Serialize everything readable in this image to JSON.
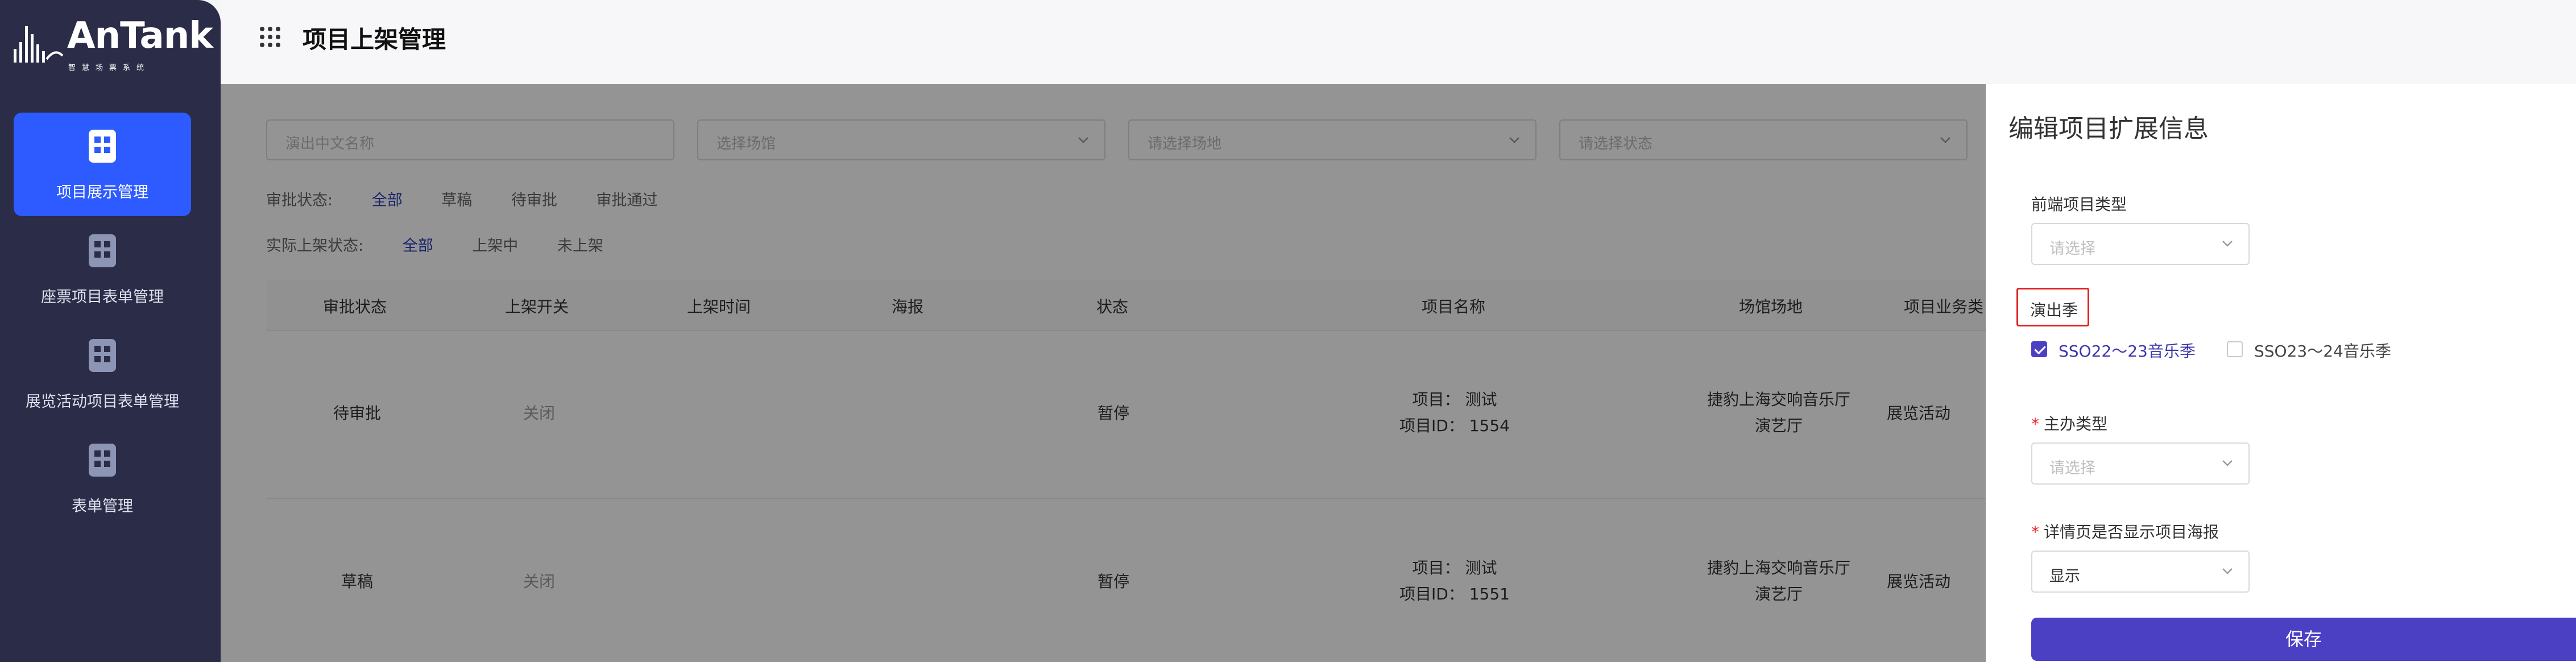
{
  "app": {
    "logo": {
      "name": "AnTank",
      "subtitle": "智慧场票系统"
    },
    "page_title": "项目上架管理"
  },
  "sidebar": {
    "items": [
      {
        "label": "项目展示管理",
        "active": true,
        "icon": "building-icon"
      },
      {
        "label": "座票项目表单管理",
        "active": false,
        "icon": "building-icon"
      },
      {
        "label": "展览活动项目表单管理",
        "active": false,
        "icon": "building-icon"
      },
      {
        "label": "表单管理",
        "active": false,
        "icon": "building-icon"
      }
    ]
  },
  "filters": {
    "name_placeholder": "演出中文名称",
    "venue_placeholder": "选择场馆",
    "site_placeholder": "请选择场地",
    "status_placeholder": "请选择状态"
  },
  "approval_status": {
    "label": "审批状态:",
    "options": [
      "全部",
      "草稿",
      "待审批",
      "审批通过"
    ],
    "selected": "全部"
  },
  "shelf_status": {
    "label": "实际上架状态:",
    "options": [
      "全部",
      "上架中",
      "未上架"
    ],
    "selected": "全部"
  },
  "table": {
    "columns": [
      "审批状态",
      "上架开关",
      "上架时间",
      "海报",
      "状态",
      "项目名称",
      "场馆场地",
      "项目业务类"
    ],
    "rows": [
      {
        "approval": "待审批",
        "switch": "关闭",
        "time": "",
        "poster": "",
        "status": "暂停",
        "project_line1": "项目：  测试",
        "project_line2": "项目ID：  1554",
        "venue_line1": "捷豹上海交响音乐厅",
        "venue_line2": "演艺厅",
        "biz": "展览活动"
      },
      {
        "approval": "草稿",
        "switch": "关闭",
        "time": "",
        "poster": "",
        "status": "暂停",
        "project_line1": "项目：  测试",
        "project_line2": "项目ID：  1551",
        "venue_line1": "捷豹上海交响音乐厅",
        "venue_line2": "演艺厅",
        "biz": "展览活动"
      }
    ]
  },
  "drawer": {
    "title": "编辑项目扩展信息",
    "frontend_type": {
      "label": "前端项目类型",
      "placeholder": "请选择"
    },
    "season": {
      "label": "演出季",
      "options": [
        {
          "label": "SSO22～23音乐季",
          "checked": true
        },
        {
          "label": "SSO23～24音乐季",
          "checked": false
        }
      ]
    },
    "host_type": {
      "label": "主办类型",
      "required_mark": "*",
      "placeholder": "请选择"
    },
    "show_poster": {
      "label": "详情页是否显示项目海报",
      "required_mark": "*",
      "value": "显示"
    },
    "save_label": "保存"
  },
  "colors": {
    "sidebar_bg": "#2b2c47",
    "active_item": "#2d5bff",
    "primary": "#4b3fc4",
    "highlight_border": "#e02020"
  }
}
